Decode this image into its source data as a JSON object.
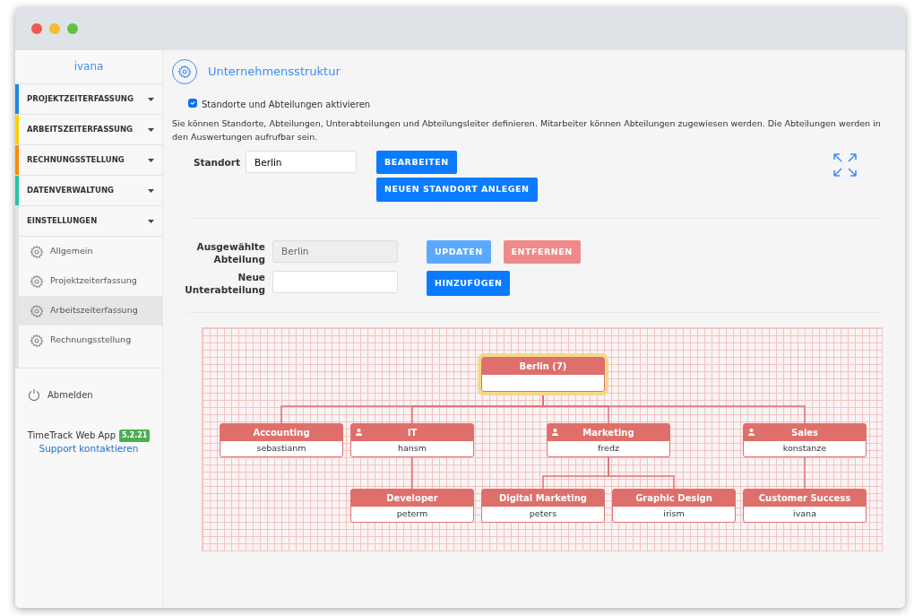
{
  "sidebar": {
    "user": "ivana",
    "items": [
      {
        "label": "PROJEKTZEITERFASSUNG",
        "color": "#1e88e5"
      },
      {
        "label": "ARBEITSZEITERFASSUNG",
        "color": "#fdd000"
      },
      {
        "label": "RECHNUNGSSTELLUNG",
        "color": "#fb8c00"
      },
      {
        "label": "DATENVERWALTUNG",
        "color": "#26c6a6"
      },
      {
        "label": "EINSTELLUNGEN",
        "color": "#e4e4e4",
        "children": [
          {
            "label": "Allgemein",
            "selected": false
          },
          {
            "label": "Projektzeiterfassung",
            "selected": false
          },
          {
            "label": "Arbeitszeiterfassung",
            "selected": true
          },
          {
            "label": "Rechnungsstellung",
            "selected": false
          }
        ]
      }
    ],
    "logout": "Abmelden",
    "app_name": "TimeTrack Web App",
    "version": "5.2.21",
    "support_link": "Support kontaktieren"
  },
  "page": {
    "title": "Unternehmensstruktur",
    "enable_checkbox": {
      "label": "Standorte und Abteilungen aktivieren",
      "checked": true
    },
    "description": "Sie können Standorte, Abteilungen, Unterabteilungen und Abteilungsleiter definieren. Mitarbeiter können Abteilungen zugewiesen werden. Die Abteilungen werden in den Auswertungen aufrufbar sein.",
    "location_label": "Standort",
    "location_value": "Berlin",
    "location_buttons": [
      "BEARBEITEN",
      "NEUEN STANDORT ANLEGEN"
    ],
    "selected_department_label": "Ausgewählte Abteilung",
    "selected_department_value": "Berlin",
    "update_button": "UPDATEN",
    "remove_button": "ENTFERNEN",
    "new_subdepartment_label": "Neue Unterabteilung",
    "add_button": "HINZUFÜGEN"
  },
  "org_chart": {
    "name": "Berlin (7)",
    "selected": true,
    "children": [
      {
        "name": "Accounting",
        "lead": "sebastianm",
        "leader_icon": false
      },
      {
        "name": "IT",
        "lead": "hansm",
        "leader_icon": true,
        "children": [
          {
            "name": "Developer",
            "lead": "peterm",
            "leader_icon": false
          }
        ]
      },
      {
        "name": "Marketing",
        "lead": "fredz",
        "leader_icon": true,
        "children": [
          {
            "name": "Digital Marketing",
            "lead": "peters",
            "leader_icon": false
          },
          {
            "name": "Graphic Design",
            "lead": "irism",
            "leader_icon": false
          }
        ]
      },
      {
        "name": "Sales",
        "lead": "konstanze",
        "leader_icon": true,
        "children": [
          {
            "name": "Customer Success",
            "lead": "ivana",
            "leader_icon": false
          }
        ]
      }
    ]
  }
}
